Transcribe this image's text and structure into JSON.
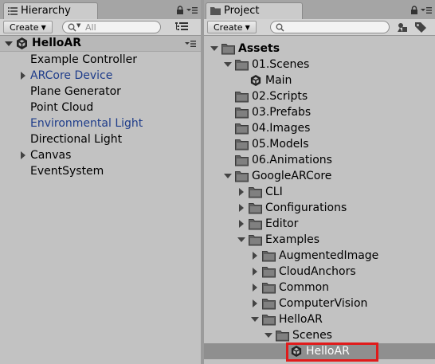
{
  "hierarchy": {
    "tab_label": "Hierarchy",
    "create_label": "Create",
    "search_placeholder": "All",
    "scene_name": "HelloAR",
    "items": [
      {
        "label": "Example Controller",
        "color": "#000000",
        "expandable": false
      },
      {
        "label": "ARCore Device",
        "color": "#1e3c8a",
        "expandable": true
      },
      {
        "label": "Plane Generator",
        "color": "#000000",
        "expandable": false
      },
      {
        "label": "Point Cloud",
        "color": "#000000",
        "expandable": false
      },
      {
        "label": "Environmental Light",
        "color": "#1e3c8a",
        "expandable": false
      },
      {
        "label": "Directional Light",
        "color": "#000000",
        "expandable": false
      },
      {
        "label": "Canvas",
        "color": "#000000",
        "expandable": true
      },
      {
        "label": "EventSystem",
        "color": "#000000",
        "expandable": false
      }
    ]
  },
  "project": {
    "tab_label": "Project",
    "create_label": "Create",
    "search_placeholder": "",
    "tree": [
      {
        "label": "Assets",
        "depth": 0,
        "arrow": "down",
        "icon": "folder",
        "bold": true
      },
      {
        "label": "01.Scenes",
        "depth": 1,
        "arrow": "down",
        "icon": "folder"
      },
      {
        "label": "Main",
        "depth": 2,
        "arrow": "none",
        "icon": "unity"
      },
      {
        "label": "02.Scripts",
        "depth": 1,
        "arrow": "none",
        "icon": "folder"
      },
      {
        "label": "03.Prefabs",
        "depth": 1,
        "arrow": "none",
        "icon": "folder"
      },
      {
        "label": "04.Images",
        "depth": 1,
        "arrow": "none",
        "icon": "folder"
      },
      {
        "label": "05.Models",
        "depth": 1,
        "arrow": "none",
        "icon": "folder"
      },
      {
        "label": "06.Animations",
        "depth": 1,
        "arrow": "none",
        "icon": "folder"
      },
      {
        "label": "GoogleARCore",
        "depth": 1,
        "arrow": "down",
        "icon": "folder"
      },
      {
        "label": "CLI",
        "depth": 2,
        "arrow": "right",
        "icon": "folder"
      },
      {
        "label": "Configurations",
        "depth": 2,
        "arrow": "right",
        "icon": "folder"
      },
      {
        "label": "Editor",
        "depth": 2,
        "arrow": "right",
        "icon": "folder"
      },
      {
        "label": "Examples",
        "depth": 2,
        "arrow": "down",
        "icon": "folder"
      },
      {
        "label": "AugmentedImage",
        "depth": 3,
        "arrow": "right",
        "icon": "folder"
      },
      {
        "label": "CloudAnchors",
        "depth": 3,
        "arrow": "right",
        "icon": "folder"
      },
      {
        "label": "Common",
        "depth": 3,
        "arrow": "right",
        "icon": "folder"
      },
      {
        "label": "ComputerVision",
        "depth": 3,
        "arrow": "right",
        "icon": "folder"
      },
      {
        "label": "HelloAR",
        "depth": 3,
        "arrow": "down",
        "icon": "folder"
      },
      {
        "label": "Scenes",
        "depth": 4,
        "arrow": "down",
        "icon": "folder"
      },
      {
        "label": "HelloAR",
        "depth": 5,
        "arrow": "none",
        "icon": "unity",
        "selected": true,
        "highlighted": true
      }
    ]
  },
  "colors": {
    "panel_bg": "#c2c2c2",
    "selection": "#8f8f8f",
    "highlight_box": "#e01b1b",
    "prefab_text": "#1e3c8a"
  },
  "icons": {
    "hierarchy_tab": "list-icon",
    "project_tab": "folder-icon",
    "lock": "lock-icon",
    "menu": "menu-icon"
  }
}
